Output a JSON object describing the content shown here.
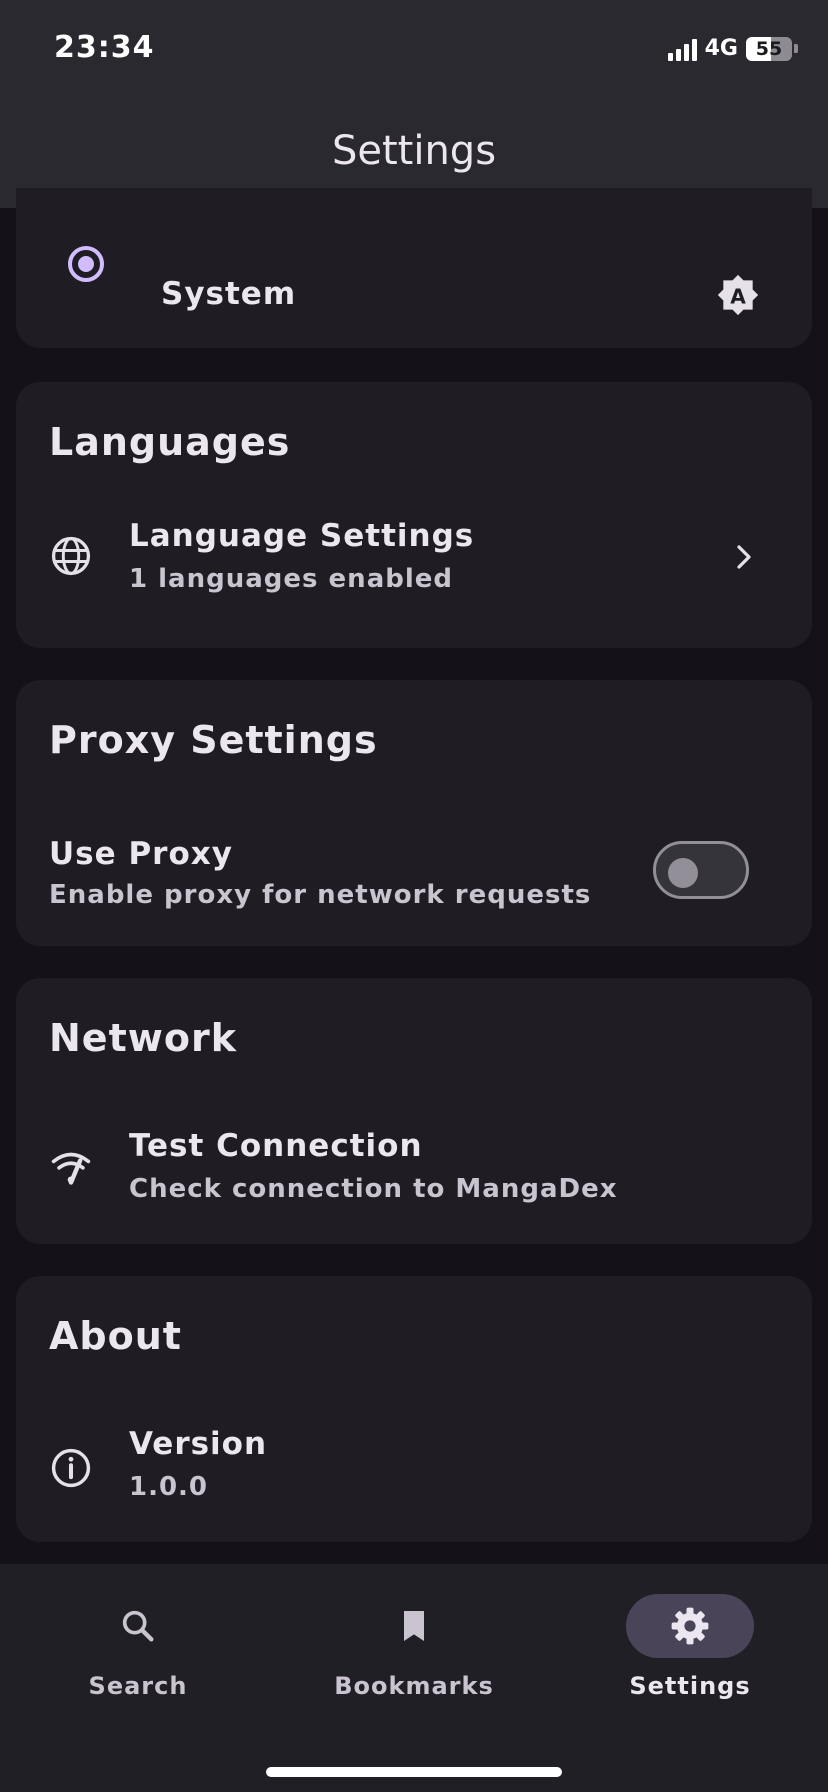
{
  "status_bar": {
    "time": "23:34",
    "network": "4G",
    "battery_level": "55"
  },
  "app_bar": {
    "title": "Settings"
  },
  "theme_card": {
    "selected_option": "System",
    "option_icon": "brightness-auto-icon"
  },
  "languages_card": {
    "title": "Languages",
    "row_title": "Language Settings",
    "row_subtitle": "1 languages enabled",
    "row_icon": "globe-icon",
    "trailing_icon": "chevron-right-icon"
  },
  "proxy_card": {
    "title": "Proxy Settings",
    "row_title": "Use Proxy",
    "row_subtitle": "Enable proxy for network requests",
    "toggle_on": false
  },
  "network_card": {
    "title": "Network",
    "row_title": "Test Connection",
    "row_subtitle": "Check connection to MangaDex",
    "row_icon": "wifi-check-icon"
  },
  "about_card": {
    "title": "About",
    "row_title": "Version",
    "row_subtitle": "1.0.0",
    "row_icon": "info-icon"
  },
  "bottom_nav": {
    "items": [
      {
        "label": "Search",
        "icon": "search-icon",
        "active": false
      },
      {
        "label": "Bookmarks",
        "icon": "bookmark-icon",
        "active": false
      },
      {
        "label": "Settings",
        "icon": "gear-icon",
        "active": true
      }
    ]
  },
  "colors": {
    "accent": "#d0bcff",
    "background": "#141218",
    "surface": "#1f1d23",
    "active_pill": "#4a4458"
  }
}
